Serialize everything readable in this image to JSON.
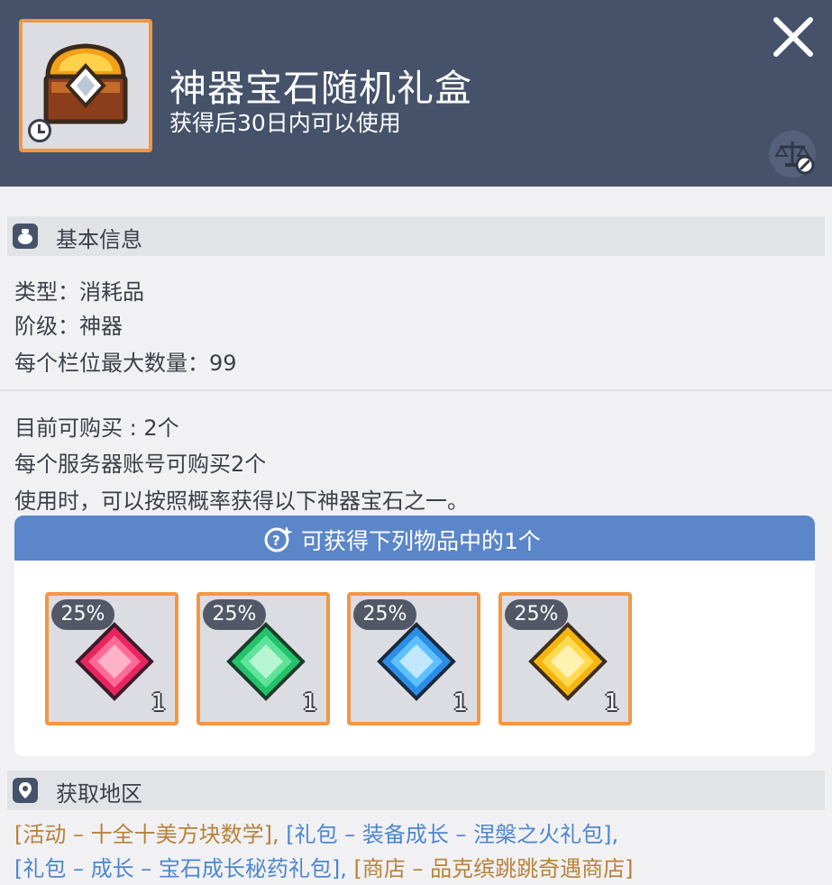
{
  "header": {
    "title": "神器宝石随机礼盒",
    "subtitle": "获得后30日内可以使用"
  },
  "basic_info": {
    "section_title": "基本信息",
    "type_line": "类型：消耗品",
    "grade_line": "阶级：神器",
    "stack_line": "每个栏位最大数量：99"
  },
  "description": {
    "purchase_line": "目前可购买 : 2个",
    "server_line": "每个服务器账号可购买2个",
    "usage_line": "使用时，可以按照概率获得以下神器宝石之一。"
  },
  "rewards": {
    "header_label": "可获得下列物品中的1个",
    "items": [
      {
        "chance": "25%",
        "qty": "1",
        "gem_color": "#e8255f"
      },
      {
        "chance": "25%",
        "qty": "1",
        "gem_color": "#22c36a"
      },
      {
        "chance": "25%",
        "qty": "1",
        "gem_color": "#2a8ee8"
      },
      {
        "chance": "25%",
        "qty": "1",
        "gem_color": "#f5b50e"
      }
    ]
  },
  "acquire": {
    "section_title": "获取地区",
    "sources": [
      "[活动 – 十全十美方块数学]",
      "[礼包 – 装备成长 – 涅槃之火礼包]",
      "[礼包 – 成长 – 宝石成长秘药礼包]",
      "[商店 – 品克缤跳跳奇遇商店]"
    ],
    "comma": ","
  },
  "colors": {
    "header_bg": "#45526a",
    "accent_orange": "#f29742",
    "reward_header_blue": "#5b86c9",
    "link_orange": "#b7823c",
    "link_blue": "#4e86cf"
  }
}
